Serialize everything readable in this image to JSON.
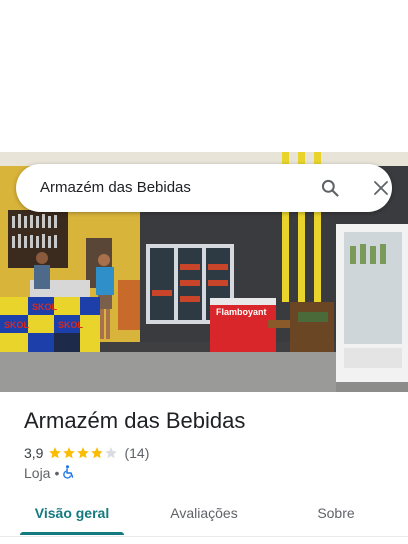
{
  "search": {
    "query": "Armazém das Bebidas",
    "search_icon": "search-icon",
    "close_icon": "close-icon"
  },
  "photo": {
    "freezer_brand": "Flamboyant",
    "crate_brand": "SKOL"
  },
  "place": {
    "name": "Armazém das Bebidas",
    "rating": "3,9",
    "rating_stars": 3.9,
    "review_count": "(14)",
    "category": "Loja",
    "separator": "•",
    "accessibility_icon": "wheelchair-icon"
  },
  "tabs": [
    {
      "label": "Visão geral",
      "active": true
    },
    {
      "label": "Avaliações",
      "active": false
    },
    {
      "label": "Sobre",
      "active": false
    }
  ],
  "colors": {
    "accent": "#137a7f",
    "star": "#fbbc04",
    "star_empty": "#dadce0",
    "accessibility": "#1a73e8"
  }
}
